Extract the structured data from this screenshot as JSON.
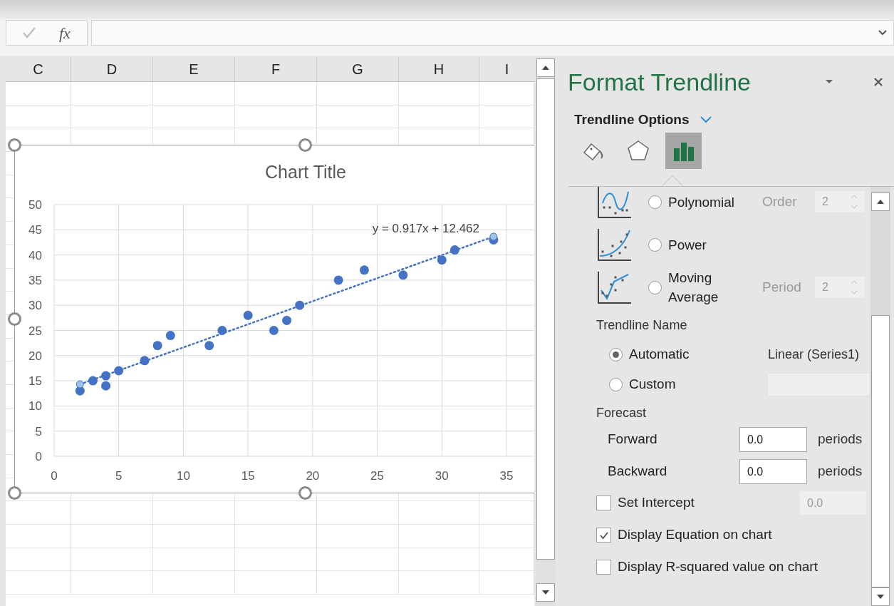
{
  "formula_bar": {
    "function_label": "fx"
  },
  "columns": [
    "C",
    "D",
    "E",
    "F",
    "G",
    "H",
    "I"
  ],
  "chart": {
    "chart_data": {
      "type": "scatter",
      "title": "Chart Title",
      "x": [
        2,
        3,
        4,
        4,
        5,
        7,
        8,
        9,
        12,
        13,
        15,
        17,
        18,
        19,
        22,
        24,
        27,
        30,
        31,
        34
      ],
      "grid": true,
      "series": [
        {
          "color": "#4472c4",
          "values": [
            13,
            15,
            16,
            14,
            17,
            19,
            22,
            24,
            22,
            25,
            28,
            25,
            27,
            30,
            35,
            37,
            36,
            39,
            41,
            43
          ]
        }
      ],
      "xlim": [
        0,
        35
      ],
      "ylim": [
        0,
        50
      ],
      "xticks": [
        0,
        5,
        10,
        15,
        20,
        25,
        30,
        35
      ],
      "yticks": [
        0,
        5,
        10,
        15,
        20,
        25,
        30,
        35,
        40,
        45,
        50
      ],
      "annotations": [
        {
          "text": "y = 0.917x + 12.462"
        }
      ]
    }
  },
  "panel": {
    "title": "Format Trendline",
    "section": "Trendline Options",
    "tabs": [
      {
        "kind": "fill",
        "selected": false
      },
      {
        "kind": "effects",
        "selected": false
      },
      {
        "kind": "options",
        "selected": true
      }
    ],
    "trendline_types": [
      {
        "kind": "polynomial",
        "label": "Polynomial",
        "selected": false,
        "param_label": "Order",
        "param_value": "2"
      },
      {
        "kind": "power",
        "label": "Power",
        "selected": false
      },
      {
        "kind": "moving_average",
        "label": "Moving Average",
        "selected": false,
        "param_label": "Period",
        "param_value": "2"
      }
    ],
    "name_heading": "Trendline Name",
    "name_options": [
      {
        "label": "Automatic",
        "selected": true,
        "value": "Linear (Series1)"
      },
      {
        "label": "Custom",
        "selected": false
      }
    ],
    "forecast_heading": "Forecast",
    "forecast": [
      {
        "label": "Forward",
        "value": "0.0",
        "unit": "periods"
      },
      {
        "label": "Backward",
        "value": "0.0",
        "unit": "periods"
      }
    ],
    "checkboxes": [
      {
        "label": "Set Intercept",
        "checked": false,
        "value": "0.0"
      },
      {
        "label": "Display Equation on chart",
        "checked": true
      },
      {
        "label": "Display R-squared value on chart",
        "checked": false
      }
    ]
  }
}
